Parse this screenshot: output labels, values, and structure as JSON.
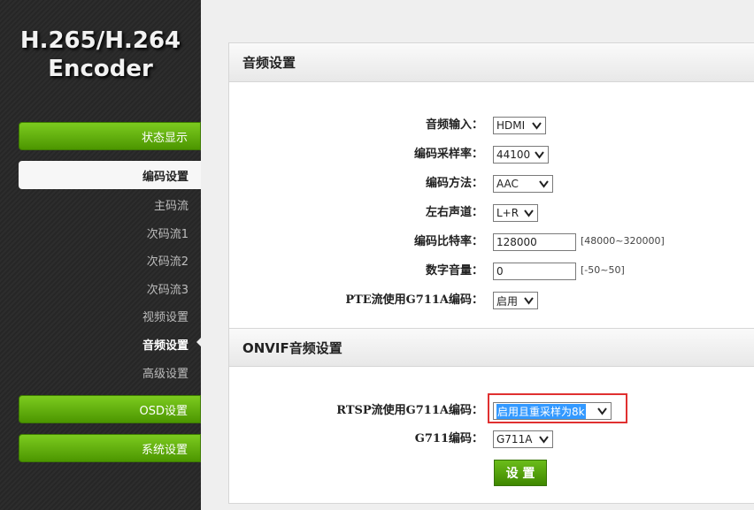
{
  "logo": {
    "line1": "H.265/H.264",
    "line2": "Encoder"
  },
  "nav": {
    "status": "状态显示",
    "encode": "编码设置",
    "sub_items": [
      "主码流",
      "次码流1",
      "次码流2",
      "次码流3",
      "视频设置",
      "音频设置",
      "高级设置"
    ],
    "active_sub": "音频设置",
    "osd": "OSD设置",
    "system": "系统设置"
  },
  "audio_section": {
    "title": "音频设置",
    "audio_input": {
      "label": "音频输入：",
      "value": "HDMI"
    },
    "sample_rate": {
      "label": "编码采样率：",
      "value": "44100"
    },
    "encode_method": {
      "label": "编码方法：",
      "value": "AAC"
    },
    "channel": {
      "label": "左右声道：",
      "value": "L+R"
    },
    "bitrate": {
      "label": "编码比特率：",
      "value": "128000",
      "hint": "[48000~320000]"
    },
    "volume": {
      "label": "数字音量：",
      "value": "0",
      "hint": "[-50~50]"
    },
    "pte_g711a": {
      "label": "PTE流使用G711A编码：",
      "value": "启用"
    }
  },
  "onvif_section": {
    "title": "ONVIF音频设置",
    "rtsp_g711a": {
      "label": "RTSP流使用G711A编码：",
      "value": "启用且重采样为8k"
    },
    "g711": {
      "label": "G711编码：",
      "value": "G711A"
    }
  },
  "save_button": "设 置",
  "colors": {
    "accent_green": "#5aa90a",
    "highlight_red": "#e03030",
    "selection_blue": "#3399ff"
  }
}
